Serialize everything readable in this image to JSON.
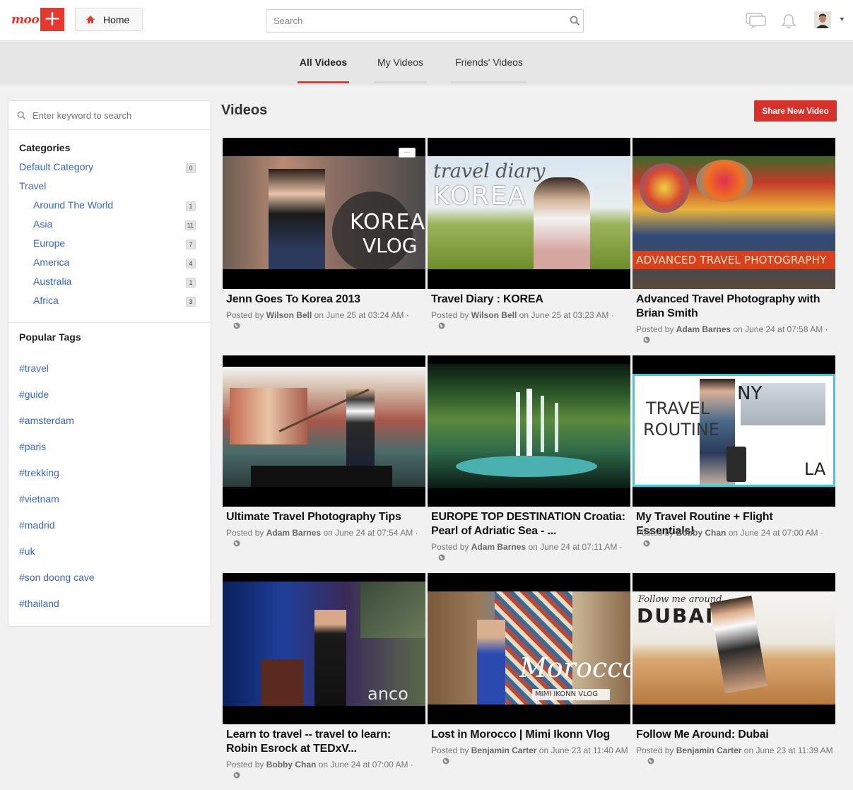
{
  "header": {
    "logo_text": "moo",
    "logo_plus": "+",
    "home_label": "Home",
    "search_placeholder": "Search",
    "icons": [
      "home-icon",
      "search-icon",
      "chat-icon",
      "bell-icon",
      "avatar",
      "caret-down-icon"
    ],
    "accent_color": "#e8372c"
  },
  "tabs": [
    {
      "label": "All Videos",
      "active": true
    },
    {
      "label": "My Videos",
      "active": false
    },
    {
      "label": "Friends' Videos",
      "active": false
    }
  ],
  "sidebar": {
    "search_placeholder": "Enter keyword to search",
    "categories_heading": "Categories",
    "categories": [
      {
        "label": "Default Category",
        "count": "0"
      },
      {
        "label": "Travel",
        "count": ""
      },
      {
        "label": "Around The World",
        "count": "1"
      },
      {
        "label": "Asia",
        "count": "11"
      },
      {
        "label": "Europe",
        "count": "7"
      },
      {
        "label": "America",
        "count": "4"
      },
      {
        "label": "Australia",
        "count": "1"
      },
      {
        "label": "Africa",
        "count": "3"
      }
    ],
    "tags_heading": "Popular Tags",
    "tags": [
      "#travel",
      "#guide",
      "#amsterdam",
      "#paris",
      "#trekking",
      "#vietnam",
      "#madrid",
      "#uk",
      "#son doong cave",
      "#thailand"
    ]
  },
  "main": {
    "title": "Videos",
    "share_button": "Share New Video",
    "videos": [
      {
        "title": "Jenn Goes To Korea 2013",
        "posted_by": "Posted by",
        "author": "Wilson Bell",
        "date": "on June 25 at 03:24 AM ·",
        "overlay": [
          "KOREA",
          "VLOG"
        ]
      },
      {
        "title": "Travel Diary : KOREA",
        "posted_by": "Posted by",
        "author": "Wilson Bell",
        "date": "on June 25 at 03:23 AM ·",
        "overlay": [
          "travel diary",
          "KOREA"
        ]
      },
      {
        "title": "Advanced Travel Photography with Brian Smith",
        "posted_by": "Posted by",
        "author": "Adam Barnes",
        "date": "on June 24 at 07:58 AM ·",
        "overlay": [
          "ADVANCED TRAVEL PHOTOGRAPHY"
        ]
      },
      {
        "title": "Ultimate Travel Photography Tips",
        "posted_by": "Posted by",
        "author": "Adam Barnes",
        "date": "on June 24 at 07:54 AM ·",
        "overlay": []
      },
      {
        "title": "EUROPE TOP DESTINATION Croatia: Pearl of Adriatic Sea - ...",
        "posted_by": "Posted by",
        "author": "Adam Barnes",
        "date": "on June 24 at 07:11 AM ·",
        "overlay": []
      },
      {
        "title": "My Travel Routine + Flight Essentials!",
        "posted_by": "Posted by",
        "author": "Bobby Chan",
        "date": "on June 24 at 07:00 AM ·",
        "overlay": [
          "TRAVEL",
          "ROUTINE",
          "NY",
          "LA"
        ]
      },
      {
        "title": "Learn to travel -- travel to learn: Robin Esrock at TEDxV...",
        "posted_by": "Posted by",
        "author": "Bobby Chan",
        "date": "on June 24 at 07:00 AM ·",
        "overlay": [
          "anco"
        ]
      },
      {
        "title": "Lost in Morocco | Mimi Ikonn Vlog",
        "posted_by": "Posted by",
        "author": "Benjamin Carter",
        "date": "on June 23 at 11:40 AM",
        "overlay": [
          "Morocco",
          "MIMI IKONN VLOG"
        ]
      },
      {
        "title": "Follow Me Around: Dubai",
        "posted_by": "Posted by",
        "author": "Benjamin Carter",
        "date": "on June 23 at 11:39 AM",
        "overlay": [
          "Follow me around",
          "DUBAI"
        ]
      }
    ]
  }
}
